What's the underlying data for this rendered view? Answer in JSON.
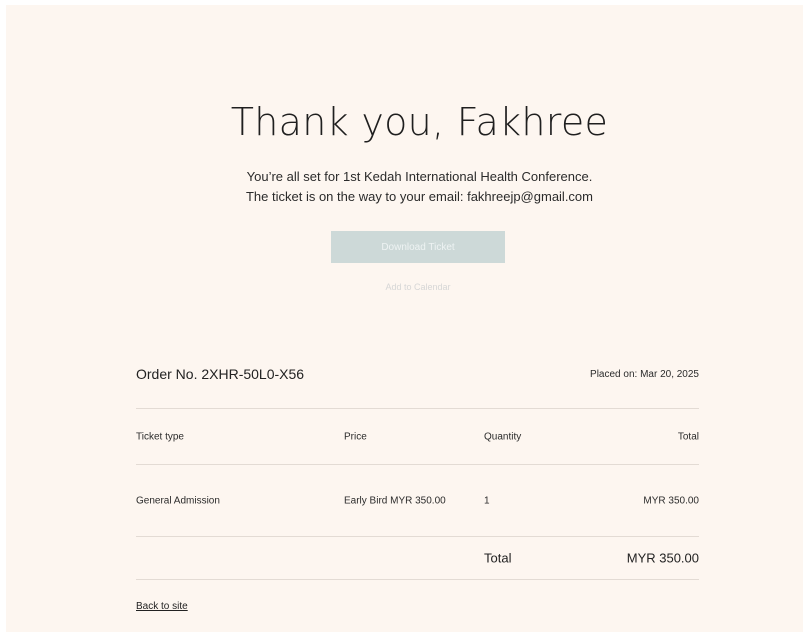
{
  "header": {
    "title": "Thank you, Fakhree",
    "line1": "You’re all set for 1st Kedah International Health Conference.",
    "line2": "The ticket is on the way to your email: fakhreejp@gmail.com"
  },
  "actions": {
    "download_label": "Download Ticket",
    "calendar_label": "Add to Calendar"
  },
  "order": {
    "number": "Order No. 2XHR-50L0-X56",
    "placed_on": "Placed on: Mar 20, 2025",
    "columns": {
      "type": "Ticket type",
      "price": "Price",
      "quantity": "Quantity",
      "total": "Total"
    },
    "items": [
      {
        "type": "General Admission",
        "price": "Early Bird MYR 350.00",
        "quantity": "1",
        "total": "MYR 350.00"
      }
    ],
    "total_label": "Total",
    "total_value": "MYR 350.00"
  },
  "footer": {
    "back_label": "Back to site"
  },
  "colors": {
    "page_background": "#fdf6f0",
    "button_background": "#cdd9d8",
    "divider": "#e3dbd4"
  }
}
